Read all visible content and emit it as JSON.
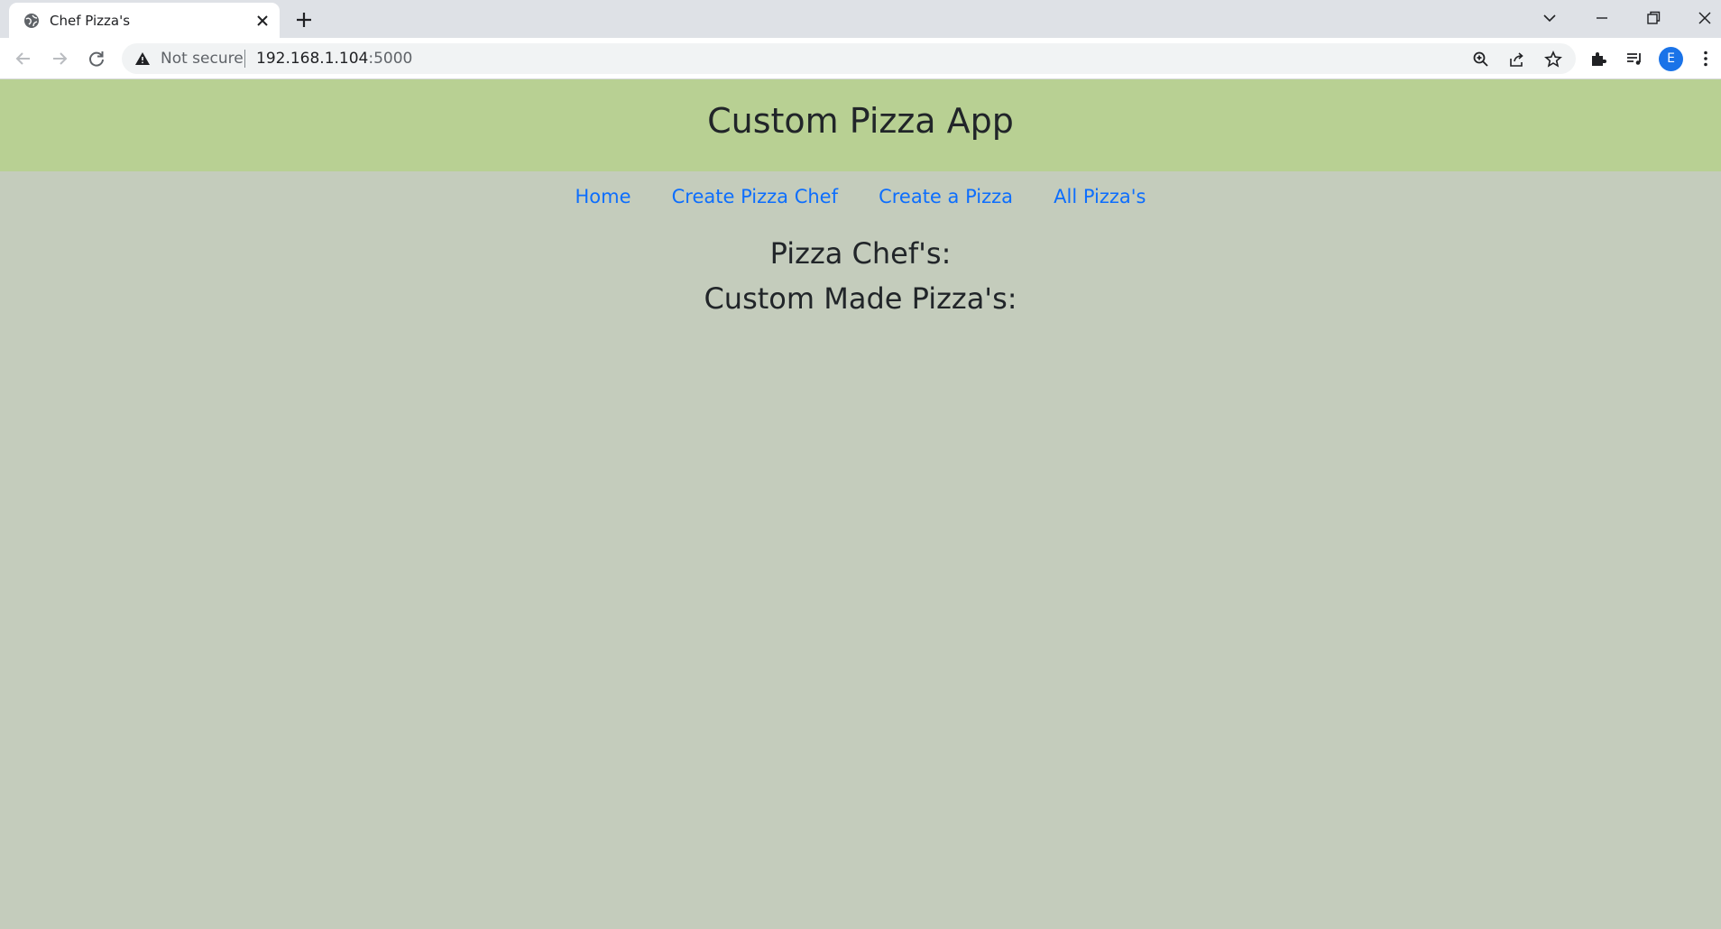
{
  "browser": {
    "tab": {
      "title": "Chef Pizza's",
      "favicon": "globe-icon"
    },
    "omnibox": {
      "security_label": "Not secure",
      "url_host": "192.168.1.104",
      "url_port": ":5000"
    },
    "profile_initial": "E"
  },
  "page": {
    "header": {
      "title": "Custom Pizza App",
      "background_color": "#b8d093"
    },
    "nav": {
      "links": [
        {
          "label": "Home"
        },
        {
          "label": "Create Pizza Chef"
        },
        {
          "label": "Create a Pizza"
        },
        {
          "label": "All Pizza's"
        }
      ],
      "link_color": "#0d6efd"
    },
    "sections": {
      "chefs_heading": "Pizza Chef's:",
      "pizzas_heading": "Custom Made Pizza's:"
    },
    "background_color": "#c4ccbc"
  }
}
